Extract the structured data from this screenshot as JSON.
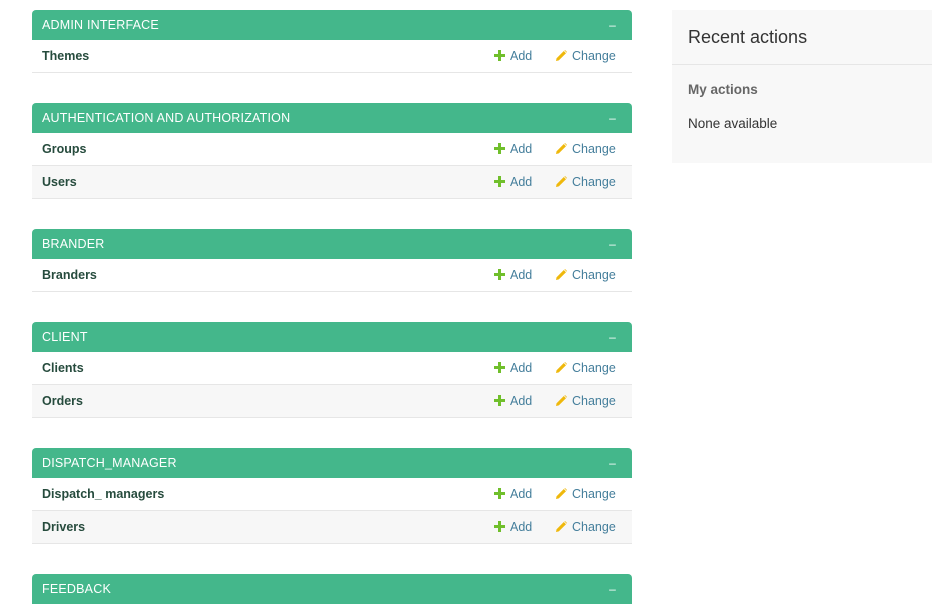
{
  "modules": [
    {
      "title": "ADMIN INTERFACE",
      "toggle": "–",
      "models": [
        {
          "name": "Themes",
          "add_label": "Add",
          "change_label": "Change"
        }
      ]
    },
    {
      "title": "AUTHENTICATION AND AUTHORIZATION",
      "toggle": "–",
      "models": [
        {
          "name": "Groups",
          "add_label": "Add",
          "change_label": "Change"
        },
        {
          "name": "Users",
          "add_label": "Add",
          "change_label": "Change"
        }
      ]
    },
    {
      "title": "BRANDER",
      "toggle": "–",
      "models": [
        {
          "name": "Branders",
          "add_label": "Add",
          "change_label": "Change"
        }
      ]
    },
    {
      "title": "CLIENT",
      "toggle": "–",
      "models": [
        {
          "name": "Clients",
          "add_label": "Add",
          "change_label": "Change"
        },
        {
          "name": "Orders",
          "add_label": "Add",
          "change_label": "Change"
        }
      ]
    },
    {
      "title": "DISPATCH_MANAGER",
      "toggle": "–",
      "models": [
        {
          "name": "Dispatch_ managers",
          "add_label": "Add",
          "change_label": "Change"
        },
        {
          "name": "Drivers",
          "add_label": "Add",
          "change_label": "Change"
        }
      ]
    },
    {
      "title": "FEEDBACK",
      "toggle": "–",
      "models": []
    }
  ],
  "recent_actions": {
    "title": "Recent actions",
    "subtitle": "My actions",
    "empty_text": "None available"
  },
  "colors": {
    "module_header": "#44b78b",
    "add_icon": "#70bf2b",
    "change_icon": "#efb80b",
    "link": "#447e9b"
  },
  "icons": {
    "add": "plus-icon",
    "change": "pencil-icon"
  }
}
